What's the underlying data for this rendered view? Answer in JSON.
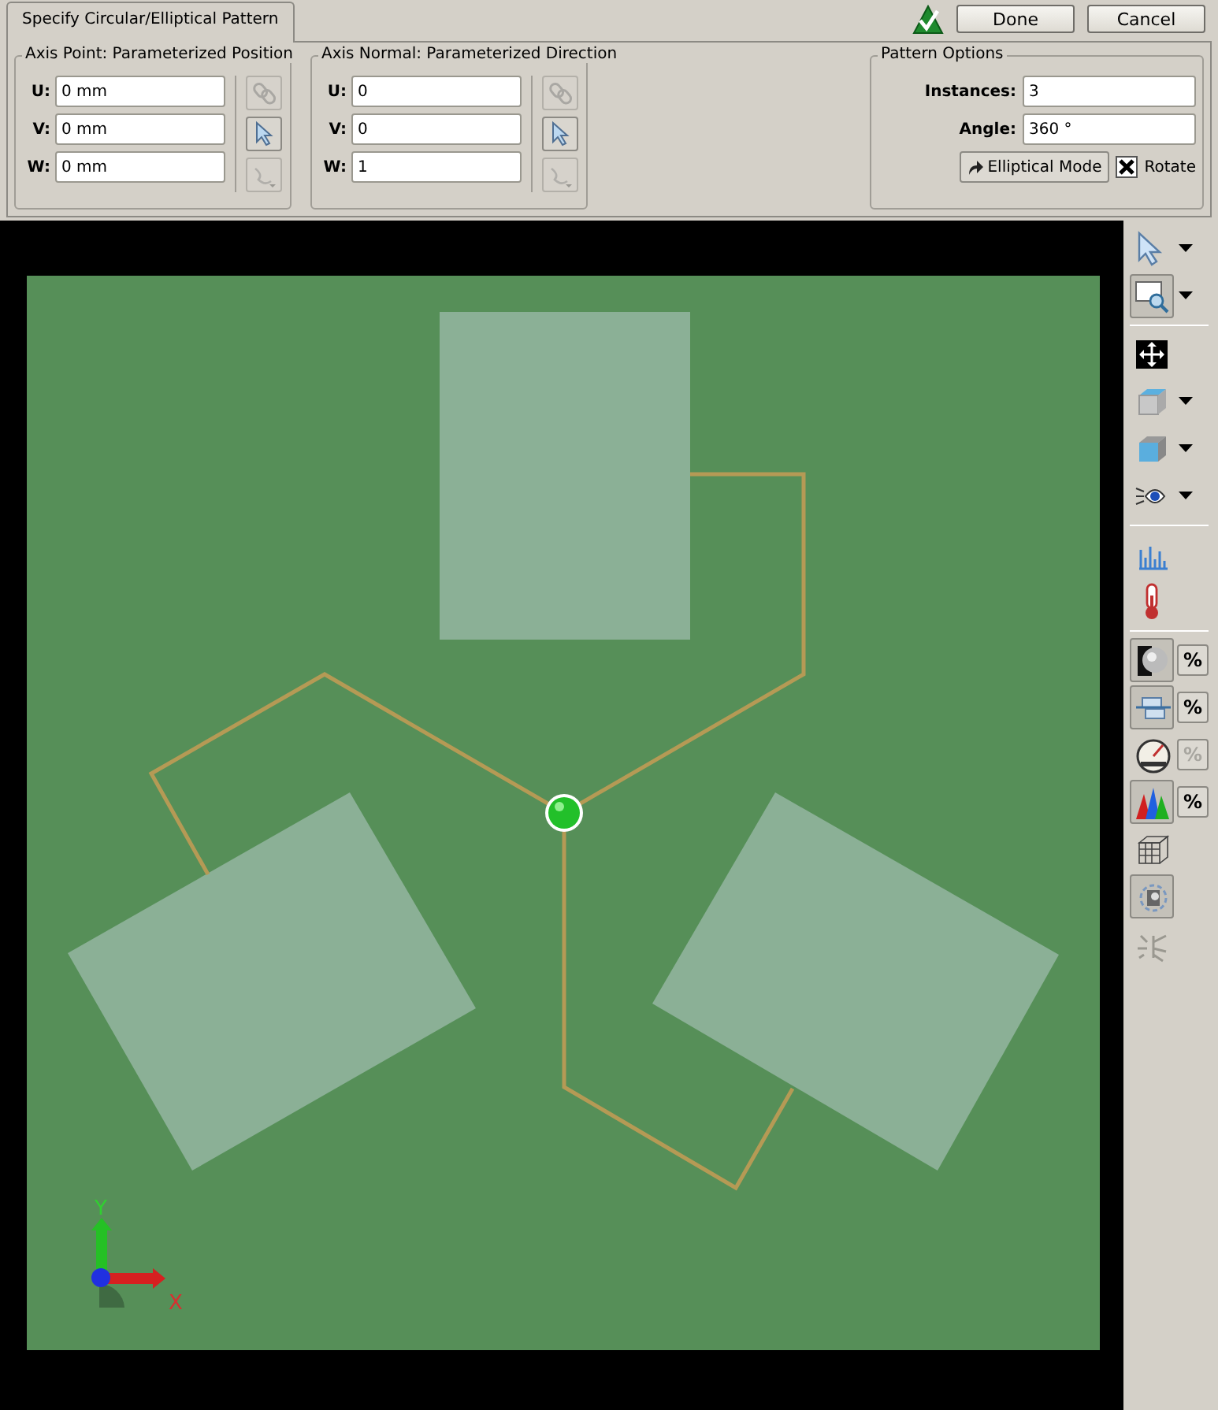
{
  "tab": {
    "label": "Specify Circular/Elliptical Pattern"
  },
  "actions": [
    {
      "kind": "accept_icon"
    },
    {
      "kind": "button",
      "label": "Done"
    },
    {
      "kind": "button",
      "label": "Cancel"
    }
  ],
  "axis_point": {
    "title": "Axis Point: Parameterized Position",
    "fields": [
      {
        "label": "U:",
        "value": "0 mm"
      },
      {
        "label": "V:",
        "value": "0 mm"
      },
      {
        "label": "W:",
        "value": "0 mm"
      }
    ],
    "tools": [
      {
        "kind": "link",
        "disabled": true
      },
      {
        "kind": "pick",
        "disabled": false
      },
      {
        "kind": "more",
        "disabled": true
      }
    ]
  },
  "axis_normal": {
    "title": "Axis Normal: Parameterized Direction",
    "fields": [
      {
        "label": "U:",
        "value": "0"
      },
      {
        "label": "V:",
        "value": "0"
      },
      {
        "label": "W:",
        "value": "1"
      }
    ],
    "tools": [
      {
        "kind": "link",
        "disabled": true
      },
      {
        "kind": "pick",
        "disabled": false
      },
      {
        "kind": "more",
        "disabled": true
      }
    ]
  },
  "pattern_options": {
    "title": "Pattern Options",
    "instances": {
      "label": "Instances:",
      "value": "3"
    },
    "angle": {
      "label": "Angle:",
      "value": "360 °"
    },
    "mode_button": "Elliptical Mode",
    "rotate": {
      "label": "Rotate",
      "checked": true
    }
  },
  "toolbar": [
    {
      "kind": "select",
      "pressed": false,
      "dropdown": true
    },
    {
      "kind": "zoom",
      "pressed": true,
      "dropdown": true
    },
    {
      "kind": "separator"
    },
    {
      "kind": "move",
      "pressed": false,
      "dropdown": false
    },
    {
      "kind": "cube_top",
      "pressed": false,
      "dropdown": true
    },
    {
      "kind": "cube_front",
      "pressed": false,
      "dropdown": true
    },
    {
      "kind": "eye",
      "pressed": false,
      "dropdown": true
    },
    {
      "kind": "separator"
    },
    {
      "kind": "bars",
      "pressed": false,
      "dropdown": false
    },
    {
      "kind": "thermometer",
      "pressed": false,
      "dropdown": false
    },
    {
      "kind": "separator"
    },
    {
      "kind": "shade",
      "pressed": true,
      "dropdown": false,
      "percent": {
        "label": "%",
        "disabled": false
      }
    },
    {
      "kind": "slots",
      "pressed": true,
      "dropdown": false,
      "percent": {
        "label": "%",
        "disabled": false
      }
    },
    {
      "kind": "gauge",
      "pressed": false,
      "dropdown": false,
      "percent": {
        "label": "%",
        "disabled": true
      }
    },
    {
      "kind": "spectrum",
      "pressed": true,
      "dropdown": false,
      "percent": {
        "label": "%",
        "disabled": false
      }
    },
    {
      "kind": "mesh",
      "pressed": false,
      "dropdown": false
    },
    {
      "kind": "gear",
      "pressed": true,
      "dropdown": false
    },
    {
      "kind": "bug",
      "pressed": false,
      "dropdown": false
    }
  ],
  "triad": {
    "x_label": "X",
    "y_label": "Y"
  }
}
